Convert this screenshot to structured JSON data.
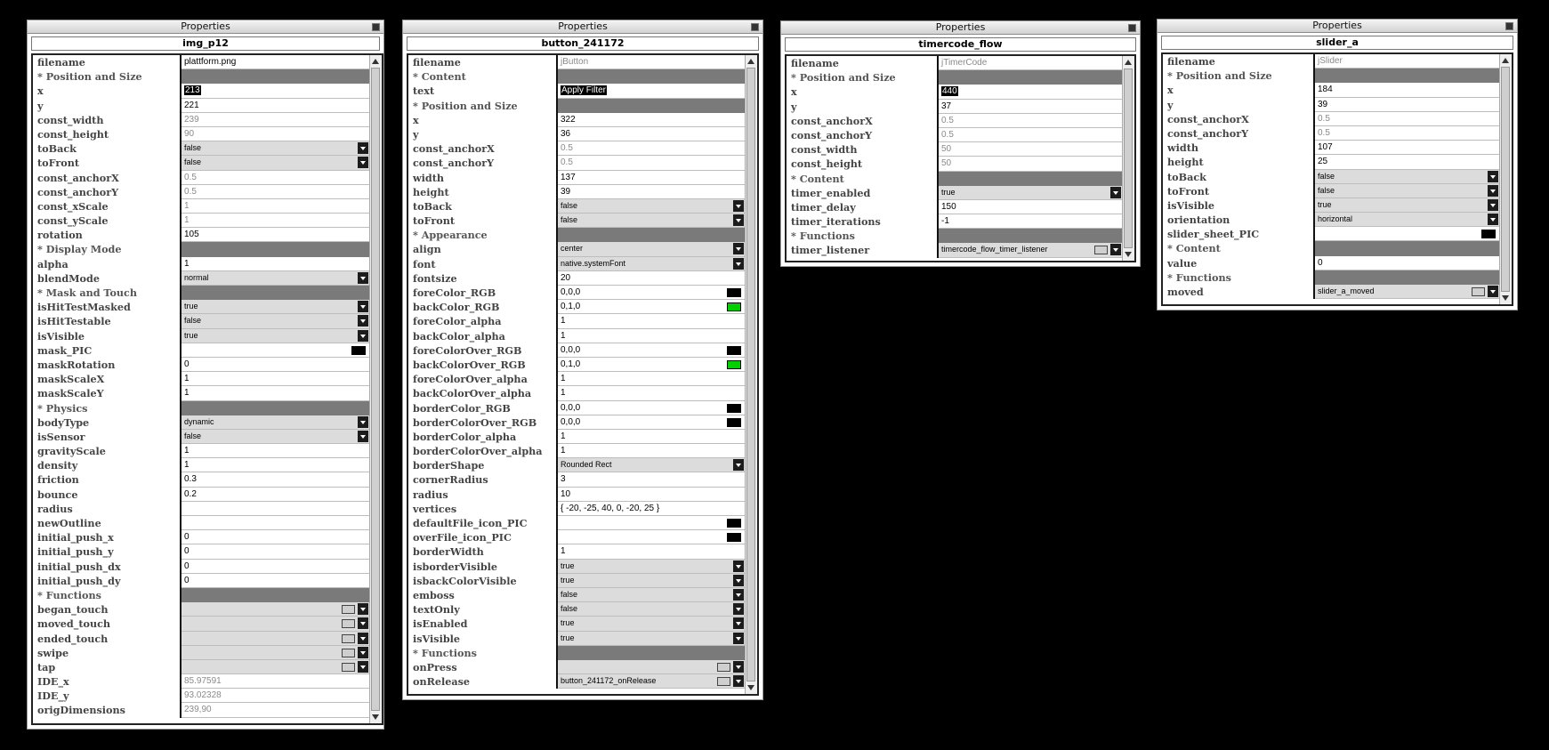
{
  "colors": {
    "black": "#000000",
    "green": "#00d000"
  },
  "panels": [
    {
      "title": "Properties",
      "name": "img_p12",
      "rows": [
        {
          "n": "filename",
          "v": "plattform.png",
          "t": "text"
        },
        {
          "n": "* Position and Size",
          "v": "",
          "t": "section"
        },
        {
          "n": "x",
          "v": "213",
          "t": "sel"
        },
        {
          "n": "y",
          "v": "221",
          "t": "text"
        },
        {
          "n": "const_width",
          "v": "239",
          "t": "ro"
        },
        {
          "n": "const_height",
          "v": "90",
          "t": "ro"
        },
        {
          "n": "toBack",
          "v": "false",
          "t": "dd"
        },
        {
          "n": "toFront",
          "v": "false",
          "t": "dd"
        },
        {
          "n": "const_anchorX",
          "v": "0.5",
          "t": "ro"
        },
        {
          "n": "const_anchorY",
          "v": "0.5",
          "t": "ro"
        },
        {
          "n": "const_xScale",
          "v": "1",
          "t": "ro"
        },
        {
          "n": "const_yScale",
          "v": "1",
          "t": "ro"
        },
        {
          "n": "rotation",
          "v": "105",
          "t": "text"
        },
        {
          "n": "* Display Mode",
          "v": "",
          "t": "section"
        },
        {
          "n": "alpha",
          "v": "1",
          "t": "text"
        },
        {
          "n": "blendMode",
          "v": "normal",
          "t": "dd"
        },
        {
          "n": "* Mask and Touch",
          "v": "",
          "t": "section"
        },
        {
          "n": "isHitTestMasked",
          "v": "true",
          "t": "dd"
        },
        {
          "n": "isHitTestable",
          "v": "false",
          "t": "dd"
        },
        {
          "n": "isVisible",
          "v": "true",
          "t": "dd"
        },
        {
          "n": "mask_PIC",
          "v": "",
          "t": "swatch",
          "c": "#000000"
        },
        {
          "n": "maskRotation",
          "v": "0",
          "t": "text"
        },
        {
          "n": "maskScaleX",
          "v": "1",
          "t": "text"
        },
        {
          "n": "maskScaleY",
          "v": "1",
          "t": "text"
        },
        {
          "n": "* Physics",
          "v": "",
          "t": "section"
        },
        {
          "n": "bodyType",
          "v": "dynamic",
          "t": "dd"
        },
        {
          "n": "isSensor",
          "v": "false",
          "t": "dd"
        },
        {
          "n": "gravityScale",
          "v": "1",
          "t": "text"
        },
        {
          "n": "density",
          "v": "1",
          "t": "text"
        },
        {
          "n": "friction",
          "v": "0.3",
          "t": "text"
        },
        {
          "n": "bounce",
          "v": "0.2",
          "t": "text"
        },
        {
          "n": "radius",
          "v": "",
          "t": "text"
        },
        {
          "n": "newOutline",
          "v": "",
          "t": "text"
        },
        {
          "n": "initial_push_x",
          "v": "0",
          "t": "text"
        },
        {
          "n": "initial_push_y",
          "v": "0",
          "t": "text"
        },
        {
          "n": "initial_push_dx",
          "v": "0",
          "t": "text"
        },
        {
          "n": "initial_push_dy",
          "v": "0",
          "t": "text"
        },
        {
          "n": "* Functions",
          "v": "",
          "t": "section"
        },
        {
          "n": "began_touch",
          "v": "",
          "t": "func"
        },
        {
          "n": "moved_touch",
          "v": "",
          "t": "func"
        },
        {
          "n": "ended_touch",
          "v": "",
          "t": "func"
        },
        {
          "n": "swipe",
          "v": "",
          "t": "func"
        },
        {
          "n": "tap",
          "v": "",
          "t": "func"
        },
        {
          "n": "IDE_x",
          "v": "85.97591",
          "t": "ro"
        },
        {
          "n": "IDE_y",
          "v": "93.02328",
          "t": "ro"
        },
        {
          "n": "origDimensions",
          "v": "239,90",
          "t": "ro"
        }
      ]
    },
    {
      "title": "Properties",
      "name": "button_241172",
      "rows": [
        {
          "n": "filename",
          "v": "jButton",
          "t": "ro"
        },
        {
          "n": "* Content",
          "v": "",
          "t": "section"
        },
        {
          "n": "text",
          "v": "Apply Filter",
          "t": "sel"
        },
        {
          "n": "* Position and Size",
          "v": "",
          "t": "section"
        },
        {
          "n": "x",
          "v": "322",
          "t": "text"
        },
        {
          "n": "y",
          "v": "36",
          "t": "text"
        },
        {
          "n": "const_anchorX",
          "v": "0.5",
          "t": "ro"
        },
        {
          "n": "const_anchorY",
          "v": "0.5",
          "t": "ro"
        },
        {
          "n": "width",
          "v": "137",
          "t": "text"
        },
        {
          "n": "height",
          "v": "39",
          "t": "text"
        },
        {
          "n": "toBack",
          "v": "false",
          "t": "dd"
        },
        {
          "n": "toFront",
          "v": "false",
          "t": "dd"
        },
        {
          "n": "* Appearance",
          "v": "",
          "t": "section"
        },
        {
          "n": "align",
          "v": "center",
          "t": "dd"
        },
        {
          "n": "font",
          "v": "native.systemFont",
          "t": "dd"
        },
        {
          "n": "fontsize",
          "v": "20",
          "t": "text"
        },
        {
          "n": "foreColor_RGB",
          "v": "0,0,0",
          "t": "swatch",
          "c": "#000000"
        },
        {
          "n": "backColor_RGB",
          "v": "0,1,0",
          "t": "swatch",
          "c": "#00d000"
        },
        {
          "n": "foreColor_alpha",
          "v": "1",
          "t": "text"
        },
        {
          "n": "backColor_alpha",
          "v": "1",
          "t": "text"
        },
        {
          "n": "foreColorOver_RGB",
          "v": "0,0,0",
          "t": "swatch",
          "c": "#000000"
        },
        {
          "n": "backColorOver_RGB",
          "v": "0,1,0",
          "t": "swatch",
          "c": "#00d000"
        },
        {
          "n": "foreColorOver_alpha",
          "v": "1",
          "t": "text"
        },
        {
          "n": "backColorOver_alpha",
          "v": "1",
          "t": "text"
        },
        {
          "n": "borderColor_RGB",
          "v": "0,0,0",
          "t": "swatch",
          "c": "#000000"
        },
        {
          "n": "borderColorOver_RGB",
          "v": "0,0,0",
          "t": "swatch",
          "c": "#000000"
        },
        {
          "n": "borderColor_alpha",
          "v": "1",
          "t": "text"
        },
        {
          "n": "borderColorOver_alpha",
          "v": "1",
          "t": "text"
        },
        {
          "n": "borderShape",
          "v": "Rounded Rect",
          "t": "dd"
        },
        {
          "n": "cornerRadius",
          "v": "3",
          "t": "text"
        },
        {
          "n": "radius",
          "v": "10",
          "t": "text"
        },
        {
          "n": "vertices",
          "v": "{ -20, -25, 40, 0, -20, 25 }",
          "t": "text"
        },
        {
          "n": "defaultFile_icon_PIC",
          "v": "",
          "t": "swatch",
          "c": "#000000"
        },
        {
          "n": "overFile_icon_PIC",
          "v": "",
          "t": "swatch",
          "c": "#000000"
        },
        {
          "n": "borderWidth",
          "v": "1",
          "t": "text"
        },
        {
          "n": "isborderVisible",
          "v": "true",
          "t": "dd"
        },
        {
          "n": "isbackColorVisible",
          "v": "true",
          "t": "dd"
        },
        {
          "n": "emboss",
          "v": "false",
          "t": "dd"
        },
        {
          "n": "textOnly",
          "v": "false",
          "t": "dd"
        },
        {
          "n": "isEnabled",
          "v": "true",
          "t": "dd"
        },
        {
          "n": "isVisible",
          "v": "true",
          "t": "dd"
        },
        {
          "n": "* Functions",
          "v": "",
          "t": "section"
        },
        {
          "n": "onPress",
          "v": "",
          "t": "func"
        },
        {
          "n": "onRelease",
          "v": "button_241172_onRelease",
          "t": "func"
        }
      ]
    },
    {
      "title": "Properties",
      "name": "timercode_flow",
      "rows": [
        {
          "n": "filename",
          "v": "jTimerCode",
          "t": "ro"
        },
        {
          "n": "* Position and Size",
          "v": "",
          "t": "section"
        },
        {
          "n": "x",
          "v": "440",
          "t": "sel"
        },
        {
          "n": "y",
          "v": "37",
          "t": "text"
        },
        {
          "n": "const_anchorX",
          "v": "0.5",
          "t": "ro"
        },
        {
          "n": "const_anchorY",
          "v": "0.5",
          "t": "ro"
        },
        {
          "n": "const_width",
          "v": "50",
          "t": "ro"
        },
        {
          "n": "const_height",
          "v": "50",
          "t": "ro"
        },
        {
          "n": "* Content",
          "v": "",
          "t": "section"
        },
        {
          "n": "timer_enabled",
          "v": "true",
          "t": "dd"
        },
        {
          "n": "timer_delay",
          "v": "150",
          "t": "text"
        },
        {
          "n": "timer_iterations",
          "v": "-1",
          "t": "text"
        },
        {
          "n": "* Functions",
          "v": "",
          "t": "section"
        },
        {
          "n": "timer_listener",
          "v": "timercode_flow_timer_listener",
          "t": "func"
        }
      ]
    },
    {
      "title": "Properties",
      "name": "slider_a",
      "rows": [
        {
          "n": "filename",
          "v": "jSlider",
          "t": "ro"
        },
        {
          "n": "* Position and Size",
          "v": "",
          "t": "section"
        },
        {
          "n": "x",
          "v": "184",
          "t": "text"
        },
        {
          "n": "y",
          "v": "39",
          "t": "text"
        },
        {
          "n": "const_anchorX",
          "v": "0.5",
          "t": "ro"
        },
        {
          "n": "const_anchorY",
          "v": "0.5",
          "t": "ro"
        },
        {
          "n": "width",
          "v": "107",
          "t": "text"
        },
        {
          "n": "height",
          "v": "25",
          "t": "text"
        },
        {
          "n": "toBack",
          "v": "false",
          "t": "dd"
        },
        {
          "n": "toFront",
          "v": "false",
          "t": "dd"
        },
        {
          "n": "isVisible",
          "v": "true",
          "t": "dd"
        },
        {
          "n": "orientation",
          "v": "horizontal",
          "t": "dd"
        },
        {
          "n": "slider_sheet_PIC",
          "v": "",
          "t": "swatch",
          "c": "#000000"
        },
        {
          "n": "* Content",
          "v": "",
          "t": "section"
        },
        {
          "n": "value",
          "v": "0",
          "t": "text"
        },
        {
          "n": "* Functions",
          "v": "",
          "t": "section"
        },
        {
          "n": "moved",
          "v": "slider_a_moved",
          "t": "func"
        }
      ]
    }
  ]
}
